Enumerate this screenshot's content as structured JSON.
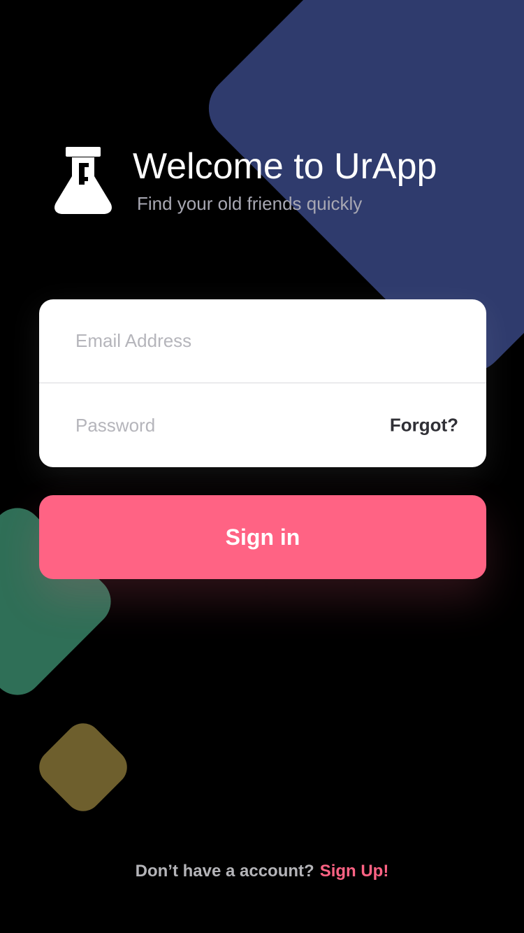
{
  "header": {
    "title": "Welcome to UrApp",
    "subtitle": "Find your old friends quickly",
    "logo_icon": "flask-icon"
  },
  "form": {
    "email_placeholder": "Email Address",
    "password_placeholder": "Password",
    "forgot_label": "Forgot?",
    "submit_label": "Sign in"
  },
  "footer": {
    "prompt": "Don’t have a account?",
    "link_label": "Sign Up!"
  },
  "colors": {
    "background": "#000000",
    "accent": "#ff6384",
    "blue_shape": "#2f3b6d",
    "green_shape": "#2f6f57",
    "gold_shape": "#6e5f2d"
  }
}
